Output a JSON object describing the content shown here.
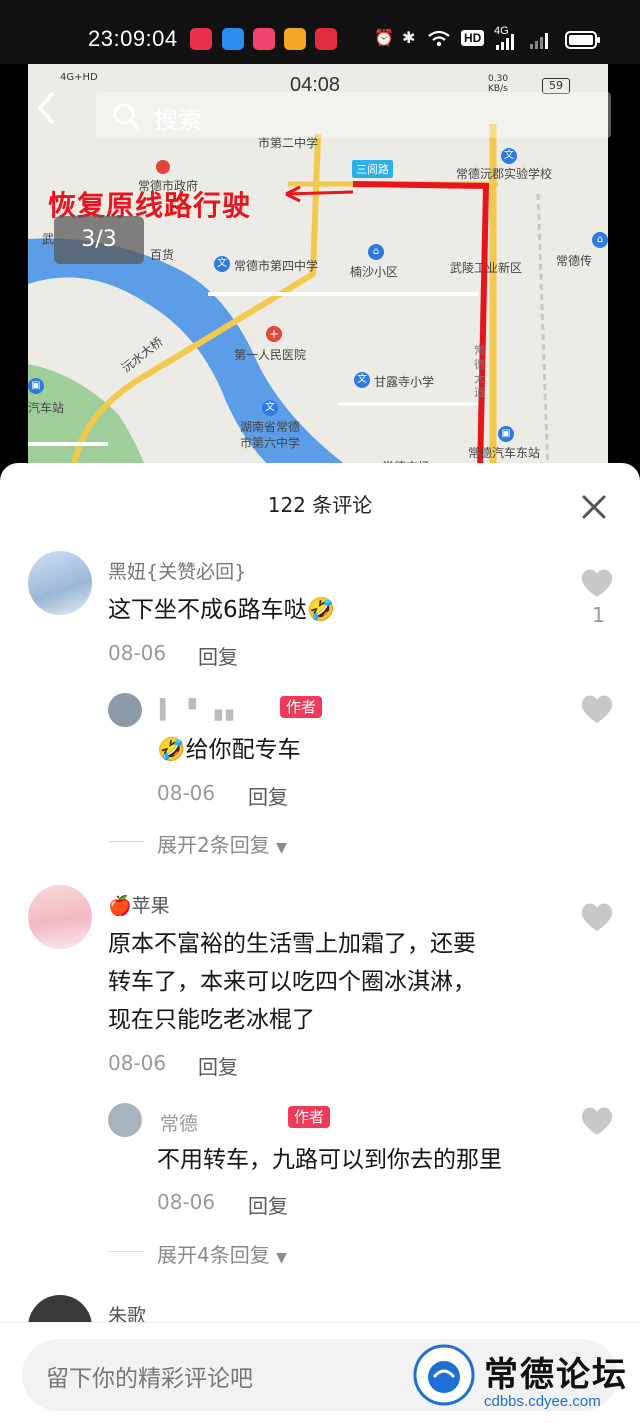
{
  "status_bar": {
    "time": "23:09:04",
    "hd_label": "HD",
    "net_label": "4G"
  },
  "inner_phone": {
    "time": "04:08",
    "net": "4G+HD",
    "speed": "0.30 KB/s",
    "battery": "59"
  },
  "viewer": {
    "search_placeholder": "搜索",
    "pager": "3/3",
    "overlay_text": "恢复原线路行驶",
    "map_labels": {
      "gov": "常德市政府",
      "school2": "市第二中学",
      "sanlu": "三闾路",
      "experiment_school": "常德沅郡实验学校",
      "department": "百货",
      "school4": "常德市第四中学",
      "nansha": "楠沙小区",
      "wuling": "武陵工业新区",
      "changde_news": "常德传",
      "hospital": "第一人民医院",
      "ganlu": "甘露寺小学",
      "yuanshui_bridge": "沅水大桥",
      "bus_station_left": "汽车站",
      "hunan_school_a": "湖南省常德",
      "hunan_school_b": "市第六中学",
      "east_station": "常德汽车东站",
      "bottom_cut": "常德市场",
      "wu": "武",
      "road_vertical": "常德大道"
    }
  },
  "comments_panel": {
    "title": "122 条评论",
    "input_placeholder": "留下你的精彩评论吧",
    "watermark_title": "常德论坛",
    "watermark_url": "cdbbs.cdyee.com",
    "comments": [
      {
        "name": "黑妞{关赞必回}",
        "text": "这下坐不成6路车哒🤣",
        "date": "08-06",
        "reply_label": "回复",
        "likes": "1",
        "replies": [
          {
            "name": "▍ ▘▗▖",
            "badge": "作者",
            "text": "🤣给你配专车",
            "date": "08-06",
            "reply_label": "回复"
          }
        ],
        "expand": "展开2条回复"
      },
      {
        "name": "🍎苹果",
        "lines": [
          "原本不富裕的生活雪上加霜了，还要",
          "转车了，本来可以吃四个圈冰淇淋，",
          "现在只能吃老冰棍了"
        ],
        "date": "08-06",
        "reply_label": "回复",
        "replies": [
          {
            "name": "常德",
            "badge": "作者",
            "text": "不用转车，九路可以到你去的那里",
            "date": "08-06",
            "reply_label": "回复"
          }
        ],
        "expand": "展开4条回复"
      },
      {
        "name": "朱歌"
      }
    ]
  },
  "colors": {
    "accent_red": "#f03a5a",
    "route_red": "#e8141e",
    "river_blue": "#5b9de6",
    "road_yellow": "#f2c94c"
  }
}
